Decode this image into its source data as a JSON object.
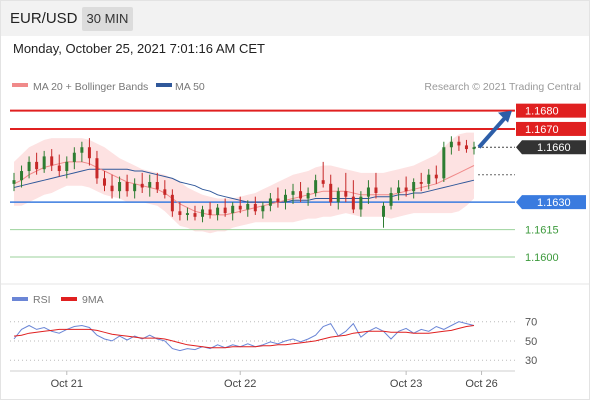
{
  "header": {
    "pair": "EUR/USD",
    "timeframe": "30 MIN"
  },
  "datetime": "Monday, October 25, 2021 7:01:16 AM CET",
  "legend": {
    "ma20": "MA 20 + Bollinger Bands",
    "ma50": "MA 50",
    "copyright": "Research © 2021 Trading Central",
    "rsi": "RSI",
    "rsi_ma": "9MA"
  },
  "colors": {
    "resistance": "#e02020",
    "current": "#333333",
    "support": "#3a7bdf",
    "target_support": "#3c9a3c",
    "arrow": "#2d5ea8",
    "ma20": "#f08a8a",
    "ma50": "#30589a",
    "bands": "#fde2e2",
    "bull": "#2e7d32",
    "bear": "#c62828"
  },
  "chart_data": [
    {
      "type": "candlestick",
      "ylim": [
        1.1588,
        1.1688
      ],
      "x_ticks": [
        {
          "label": "Oct 21",
          "i": 7
        },
        {
          "label": "Oct 22",
          "i": 30
        },
        {
          "label": "Oct 23",
          "i": 52
        },
        {
          "label": "Oct 26",
          "i": 62
        }
      ],
      "levels": [
        {
          "label": "1.1680",
          "value": 1.168,
          "kind": "resistance"
        },
        {
          "label": "1.1670",
          "value": 1.167,
          "kind": "resistance"
        },
        {
          "label": "1.1660",
          "value": 1.166,
          "kind": "current"
        },
        {
          "label": "1.1630",
          "value": 1.163,
          "kind": "support"
        },
        {
          "label": "1.1615",
          "value": 1.1615,
          "kind": "target_support"
        },
        {
          "label": "1.1600",
          "value": 1.16,
          "kind": "target_support"
        }
      ],
      "ohlc": [
        [
          1.164,
          1.1646,
          1.1636,
          1.1642
        ],
        [
          1.1642,
          1.165,
          1.1638,
          1.1647
        ],
        [
          1.1647,
          1.1655,
          1.1643,
          1.1652
        ],
        [
          1.1652,
          1.1657,
          1.1645,
          1.1648
        ],
        [
          1.1648,
          1.1658,
          1.1646,
          1.1655
        ],
        [
          1.1655,
          1.1659,
          1.1647,
          1.165
        ],
        [
          1.165,
          1.1656,
          1.1644,
          1.1647
        ],
        [
          1.1647,
          1.1655,
          1.1643,
          1.1652
        ],
        [
          1.1652,
          1.166,
          1.1648,
          1.1657
        ],
        [
          1.1657,
          1.1663,
          1.1652,
          1.166
        ],
        [
          1.166,
          1.1665,
          1.165,
          1.1654
        ],
        [
          1.1654,
          1.1658,
          1.164,
          1.1643
        ],
        [
          1.1643,
          1.1647,
          1.1636,
          1.1639
        ],
        [
          1.1639,
          1.1645,
          1.1632,
          1.1636
        ],
        [
          1.1636,
          1.1644,
          1.1632,
          1.1641
        ],
        [
          1.1641,
          1.1645,
          1.1633,
          1.1636
        ],
        [
          1.1636,
          1.1643,
          1.1632,
          1.164
        ],
        [
          1.164,
          1.1646,
          1.1635,
          1.1638
        ],
        [
          1.1638,
          1.1645,
          1.1633,
          1.1641
        ],
        [
          1.1641,
          1.1646,
          1.1635,
          1.1637
        ],
        [
          1.1637,
          1.1642,
          1.1632,
          1.1634
        ],
        [
          1.1634,
          1.1637,
          1.1622,
          1.1625
        ],
        [
          1.1625,
          1.163,
          1.162,
          1.1623
        ],
        [
          1.1623,
          1.1627,
          1.162,
          1.1624
        ],
        [
          1.1624,
          1.1628,
          1.162,
          1.1622
        ],
        [
          1.1622,
          1.1628,
          1.1619,
          1.1626
        ],
        [
          1.1626,
          1.163,
          1.1621,
          1.1623
        ],
        [
          1.1623,
          1.1629,
          1.162,
          1.1627
        ],
        [
          1.1627,
          1.1632,
          1.1622,
          1.1624
        ],
        [
          1.1624,
          1.163,
          1.162,
          1.1628
        ],
        [
          1.1628,
          1.1633,
          1.1624,
          1.1626
        ],
        [
          1.1626,
          1.1631,
          1.1622,
          1.1629
        ],
        [
          1.1629,
          1.1633,
          1.1623,
          1.1625
        ],
        [
          1.1625,
          1.163,
          1.1621,
          1.1628
        ],
        [
          1.1628,
          1.1635,
          1.1625,
          1.1632
        ],
        [
          1.1632,
          1.1638,
          1.1627,
          1.163
        ],
        [
          1.163,
          1.1637,
          1.1626,
          1.1634
        ],
        [
          1.1634,
          1.164,
          1.1629,
          1.1636
        ],
        [
          1.1636,
          1.1641,
          1.163,
          1.1632
        ],
        [
          1.1632,
          1.1638,
          1.1628,
          1.1635
        ],
        [
          1.1635,
          1.1645,
          1.1633,
          1.1642
        ],
        [
          1.1642,
          1.1652,
          1.1638,
          1.164
        ],
        [
          1.164,
          1.1645,
          1.1628,
          1.163
        ],
        [
          1.163,
          1.1638,
          1.1626,
          1.1636
        ],
        [
          1.1636,
          1.1646,
          1.163,
          1.1633
        ],
        [
          1.1633,
          1.1642,
          1.1624,
          1.1626
        ],
        [
          1.1626,
          1.1636,
          1.1622,
          1.1633
        ],
        [
          1.1633,
          1.1642,
          1.1629,
          1.1638
        ],
        [
          1.1638,
          1.1646,
          1.1632,
          1.1635
        ],
        [
          1.1622,
          1.163,
          1.1616,
          1.1628
        ],
        [
          1.1628,
          1.1638,
          1.1626,
          1.1635
        ],
        [
          1.1635,
          1.1642,
          1.1631,
          1.1638
        ],
        [
          1.1638,
          1.1644,
          1.1633,
          1.1636
        ],
        [
          1.1636,
          1.1643,
          1.1632,
          1.1641
        ],
        [
          1.1641,
          1.1646,
          1.1636,
          1.164
        ],
        [
          1.164,
          1.1648,
          1.1637,
          1.1645
        ],
        [
          1.1645,
          1.165,
          1.164,
          1.1643
        ],
        [
          1.1643,
          1.1663,
          1.1641,
          1.166
        ],
        [
          1.166,
          1.1666,
          1.1656,
          1.1663
        ],
        [
          1.1663,
          1.1666,
          1.1658,
          1.1661
        ],
        [
          1.1661,
          1.1664,
          1.1657,
          1.1659
        ],
        [
          1.1659,
          1.1663,
          1.1656,
          1.166
        ]
      ],
      "ma20": [
        1.164,
        1.1642,
        1.1645,
        1.1647,
        1.1649,
        1.165,
        1.1651,
        1.1652,
        1.1652,
        1.1652,
        1.1651,
        1.1649,
        1.1647,
        1.1645,
        1.1643,
        1.1641,
        1.164,
        1.1639,
        1.1638,
        1.1637,
        1.1635,
        1.1632,
        1.1629,
        1.1627,
        1.1625,
        1.1624,
        1.1623,
        1.1623,
        1.1623,
        1.1624,
        1.1625,
        1.1626,
        1.1627,
        1.1628,
        1.1629,
        1.163,
        1.1631,
        1.1632,
        1.1633,
        1.1634,
        1.1635,
        1.1636,
        1.1636,
        1.1636,
        1.1636,
        1.1635,
        1.1634,
        1.1634,
        1.1634,
        1.1634,
        1.1634,
        1.1635,
        1.1636,
        1.1637,
        1.1638,
        1.1639,
        1.164,
        1.1642,
        1.1644,
        1.1646,
        1.1648,
        1.165
      ],
      "bb_upper": [
        1.1652,
        1.1656,
        1.166,
        1.1662,
        1.1664,
        1.1665,
        1.1665,
        1.1665,
        1.1665,
        1.1665,
        1.1664,
        1.1662,
        1.166,
        1.1657,
        1.1654,
        1.1652,
        1.165,
        1.1648,
        1.1647,
        1.1646,
        1.1645,
        1.1643,
        1.1641,
        1.1638,
        1.1636,
        1.1634,
        1.1633,
        1.1632,
        1.1632,
        1.1632,
        1.1633,
        1.1634,
        1.1635,
        1.1637,
        1.1639,
        1.1641,
        1.1643,
        1.1645,
        1.1646,
        1.1647,
        1.1649,
        1.165,
        1.165,
        1.1649,
        1.1648,
        1.1647,
        1.1646,
        1.1646,
        1.1646,
        1.1646,
        1.1647,
        1.1648,
        1.1649,
        1.165,
        1.1652,
        1.1654,
        1.1656,
        1.166,
        1.1664,
        1.1667,
        1.1668,
        1.1668
      ],
      "bb_lower": [
        1.1628,
        1.1628,
        1.163,
        1.1632,
        1.1634,
        1.1635,
        1.1637,
        1.1639,
        1.1639,
        1.1639,
        1.1638,
        1.1636,
        1.1634,
        1.1633,
        1.1632,
        1.163,
        1.163,
        1.163,
        1.1629,
        1.1628,
        1.1625,
        1.1621,
        1.1617,
        1.1616,
        1.1614,
        1.1614,
        1.1613,
        1.1614,
        1.1614,
        1.1616,
        1.1617,
        1.1618,
        1.1619,
        1.1619,
        1.1619,
        1.1619,
        1.1619,
        1.1619,
        1.162,
        1.1621,
        1.1621,
        1.1622,
        1.1622,
        1.1623,
        1.1624,
        1.1623,
        1.1622,
        1.1622,
        1.1622,
        1.1622,
        1.1621,
        1.1622,
        1.1623,
        1.1624,
        1.1624,
        1.1624,
        1.1624,
        1.1624,
        1.1624,
        1.1625,
        1.1628,
        1.1632
      ],
      "ma50": [
        1.1638,
        1.1639,
        1.164,
        1.1641,
        1.1642,
        1.1643,
        1.1644,
        1.1645,
        1.1646,
        1.1647,
        1.1648,
        1.1648,
        1.1648,
        1.1648,
        1.1648,
        1.1648,
        1.1647,
        1.1647,
        1.1646,
        1.1645,
        1.1644,
        1.1643,
        1.1641,
        1.164,
        1.1639,
        1.1637,
        1.1636,
        1.1634,
        1.1633,
        1.1632,
        1.1631,
        1.163,
        1.163,
        1.163,
        1.163,
        1.163,
        1.163,
        1.1631,
        1.1631,
        1.1631,
        1.1632,
        1.1632,
        1.1632,
        1.1632,
        1.1632,
        1.1632,
        1.1632,
        1.1632,
        1.1633,
        1.1633,
        1.1633,
        1.1634,
        1.1634,
        1.1635,
        1.1635,
        1.1636,
        1.1637,
        1.1638,
        1.1639,
        1.164,
        1.1641,
        1.1642
      ]
    },
    {
      "type": "line",
      "ylim": [
        25,
        78
      ],
      "y_ticks": [
        70,
        50,
        30
      ],
      "series": [
        {
          "name": "RSI",
          "values": [
            52,
            62,
            66,
            62,
            64,
            60,
            58,
            62,
            65,
            66,
            64,
            56,
            52,
            50,
            55,
            51,
            55,
            52,
            56,
            52,
            50,
            42,
            40,
            42,
            41,
            44,
            42,
            46,
            43,
            46,
            44,
            47,
            44,
            46,
            49,
            47,
            50,
            52,
            49,
            52,
            56,
            65,
            68,
            55,
            60,
            68,
            54,
            60,
            64,
            60,
            52,
            60,
            63,
            58,
            62,
            60,
            65,
            62,
            66,
            70,
            68,
            66
          ]
        },
        {
          "name": "9MA",
          "values": [
            55,
            56,
            58,
            59,
            60,
            61,
            62,
            62,
            62,
            62,
            62,
            61,
            59,
            57,
            56,
            55,
            54,
            53,
            53,
            53,
            52,
            50,
            48,
            46,
            45,
            44,
            43,
            43,
            43,
            44,
            44,
            44,
            44,
            45,
            45,
            46,
            46,
            47,
            48,
            49,
            50,
            52,
            54,
            55,
            56,
            58,
            59,
            60,
            60,
            60,
            59,
            59,
            59,
            58,
            58,
            58,
            59,
            60,
            61,
            63,
            65,
            66
          ]
        }
      ]
    }
  ]
}
